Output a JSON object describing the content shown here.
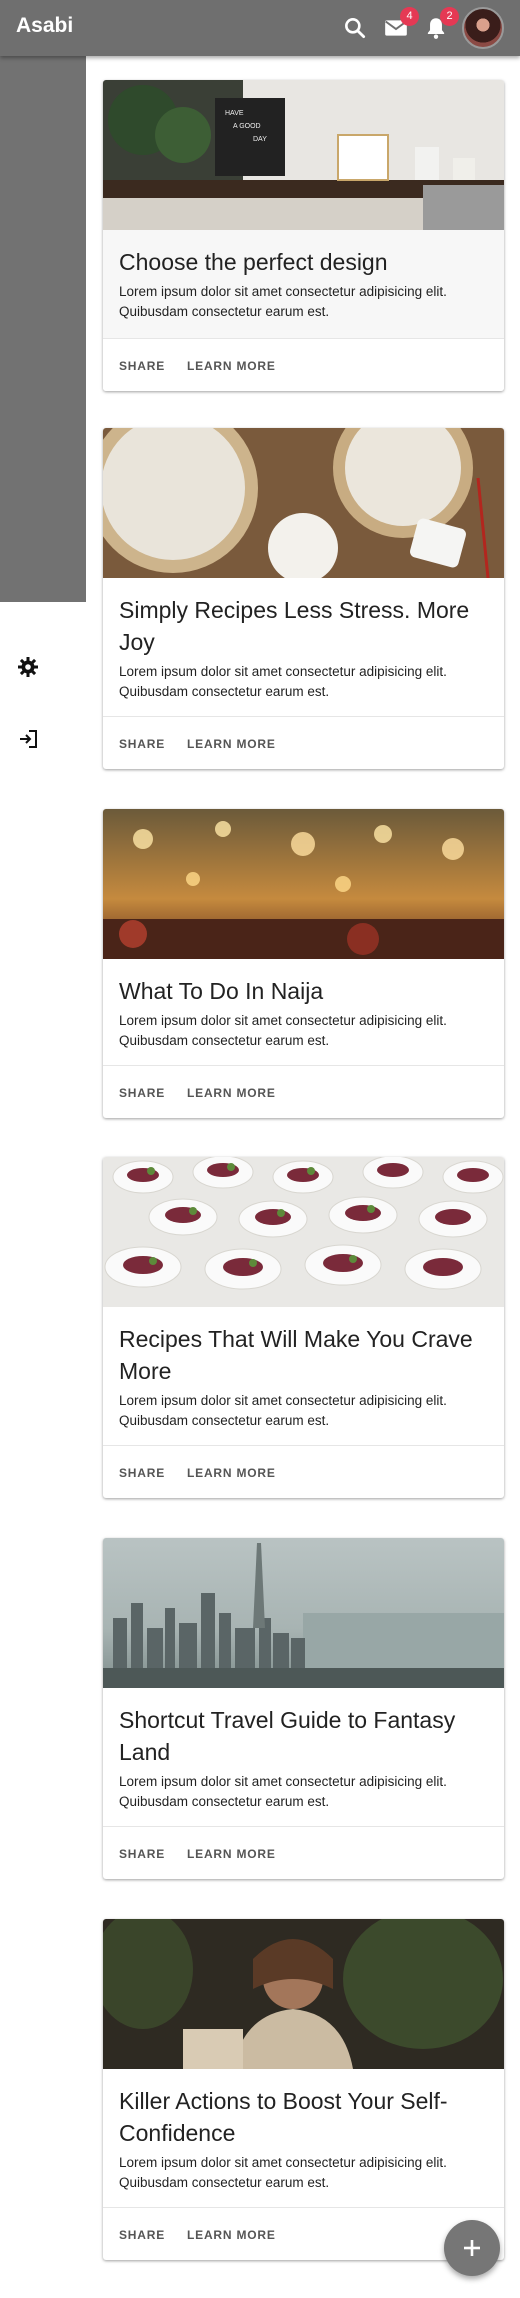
{
  "app": {
    "brand": "Asabi"
  },
  "header": {
    "mail_count": "4",
    "notification_count": "2",
    "icons": [
      "search-icon",
      "mail-icon",
      "bell-icon",
      "avatar"
    ]
  },
  "sidebar": {
    "items": [
      {
        "icon": "home-icon"
      },
      {
        "icon": "person-icon"
      },
      {
        "icon": "list-icon"
      },
      {
        "icon": "camera-icon"
      },
      {
        "icon": "play-circle-icon"
      },
      {
        "icon": "tablet-icon"
      },
      {
        "icon": "bookmark-icon"
      },
      {
        "icon": "store-icon"
      },
      {
        "icon": "gear-icon"
      },
      {
        "icon": "logout-icon"
      }
    ]
  },
  "cards": [
    {
      "title": "Choose the perfect design",
      "text": "Lorem ipsum dolor sit amet consectetur adipisicing elit. Quibusdam consectetur earum est.",
      "share": "SHARE",
      "learn": "LEARN MORE",
      "image_text": "HAVE A GOOD DAY"
    },
    {
      "title": "Simply Recipes Less Stress. More Joy",
      "text": "Lorem ipsum dolor sit amet consectetur adipisicing elit. Quibusdam consectetur earum est.",
      "share": "SHARE",
      "learn": "LEARN MORE"
    },
    {
      "title": "What To Do In Naija",
      "text": "Lorem ipsum dolor sit amet consectetur adipisicing elit. Quibusdam consectetur earum est.",
      "share": "SHARE",
      "learn": "LEARN MORE"
    },
    {
      "title": "Recipes That Will Make You Crave More",
      "text": "Lorem ipsum dolor sit amet consectetur adipisicing elit. Quibusdam consectetur earum est.",
      "share": "SHARE",
      "learn": "LEARN MORE"
    },
    {
      "title": "Shortcut Travel Guide to Fantasy Land",
      "text": "Lorem ipsum dolor sit amet consectetur adipisicing elit. Quibusdam consectetur earum est.",
      "share": "SHARE",
      "learn": "LEARN MORE"
    },
    {
      "title": "Killer Actions to Boost Your Self-Confidence",
      "text": "Lorem ipsum dolor sit amet consectetur adipisicing elit. Quibusdam consectetur earum est.",
      "share": "SHARE",
      "learn": "LEARN MORE"
    }
  ],
  "fab": {
    "icon": "plus-icon"
  }
}
